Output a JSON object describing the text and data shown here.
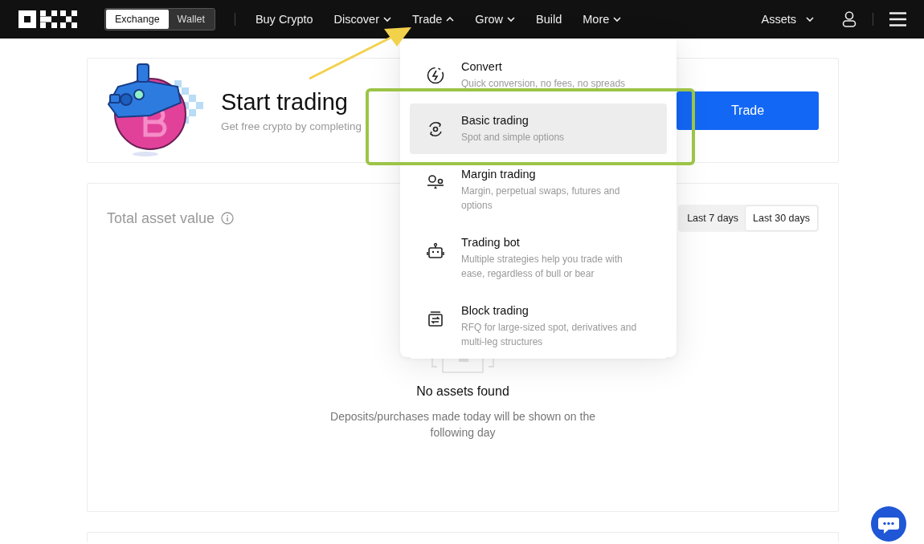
{
  "nav": {
    "mode_switch": [
      {
        "label": "Exchange",
        "selected": true
      },
      {
        "label": "Wallet",
        "selected": false
      }
    ],
    "items": [
      {
        "label": "Buy Crypto",
        "kind": "link"
      },
      {
        "label": "Discover",
        "kind": "dropdown",
        "expanded": false
      },
      {
        "label": "Trade",
        "kind": "dropdown",
        "expanded": true
      },
      {
        "label": "Grow",
        "kind": "dropdown",
        "expanded": false
      },
      {
        "label": "Build",
        "kind": "link"
      },
      {
        "label": "More",
        "kind": "dropdown",
        "expanded": false
      }
    ],
    "assets": "Assets"
  },
  "hero": {
    "title": "Start trading",
    "subtitle": "Get free crypto by completing",
    "button": "Trade"
  },
  "asset_panel": {
    "title": "Total asset value",
    "ranges": [
      {
        "label": "Last 7 days",
        "selected": false
      },
      {
        "label": "Last 30 days",
        "selected": true
      }
    ],
    "empty_title": "No assets found",
    "empty_text": "Deposits/purchases made today will be shown on the following day"
  },
  "trade_menu": [
    {
      "kind": "convert",
      "title": "Convert",
      "description": "Quick conversion, no fees, no spreads",
      "selected": false
    },
    {
      "kind": "basic",
      "title": "Basic trading",
      "description": "Spot and simple options",
      "selected": true
    },
    {
      "kind": "margin",
      "title": "Margin trading",
      "description": "Margin, perpetual swaps, futures and options",
      "selected": false
    },
    {
      "kind": "bot",
      "title": "Trading bot",
      "description": "Multiple strategies help you trade with ease, regardless of bull or bear",
      "selected": false
    },
    {
      "kind": "block",
      "title": "Block trading",
      "description": "RFQ for large-sized spot, derivatives and multi-leg structures",
      "selected": false
    }
  ],
  "annotations": [
    {
      "kind": "arrow",
      "color": "#f2d14b"
    },
    {
      "kind": "highlight",
      "color": "#9cc447"
    }
  ]
}
